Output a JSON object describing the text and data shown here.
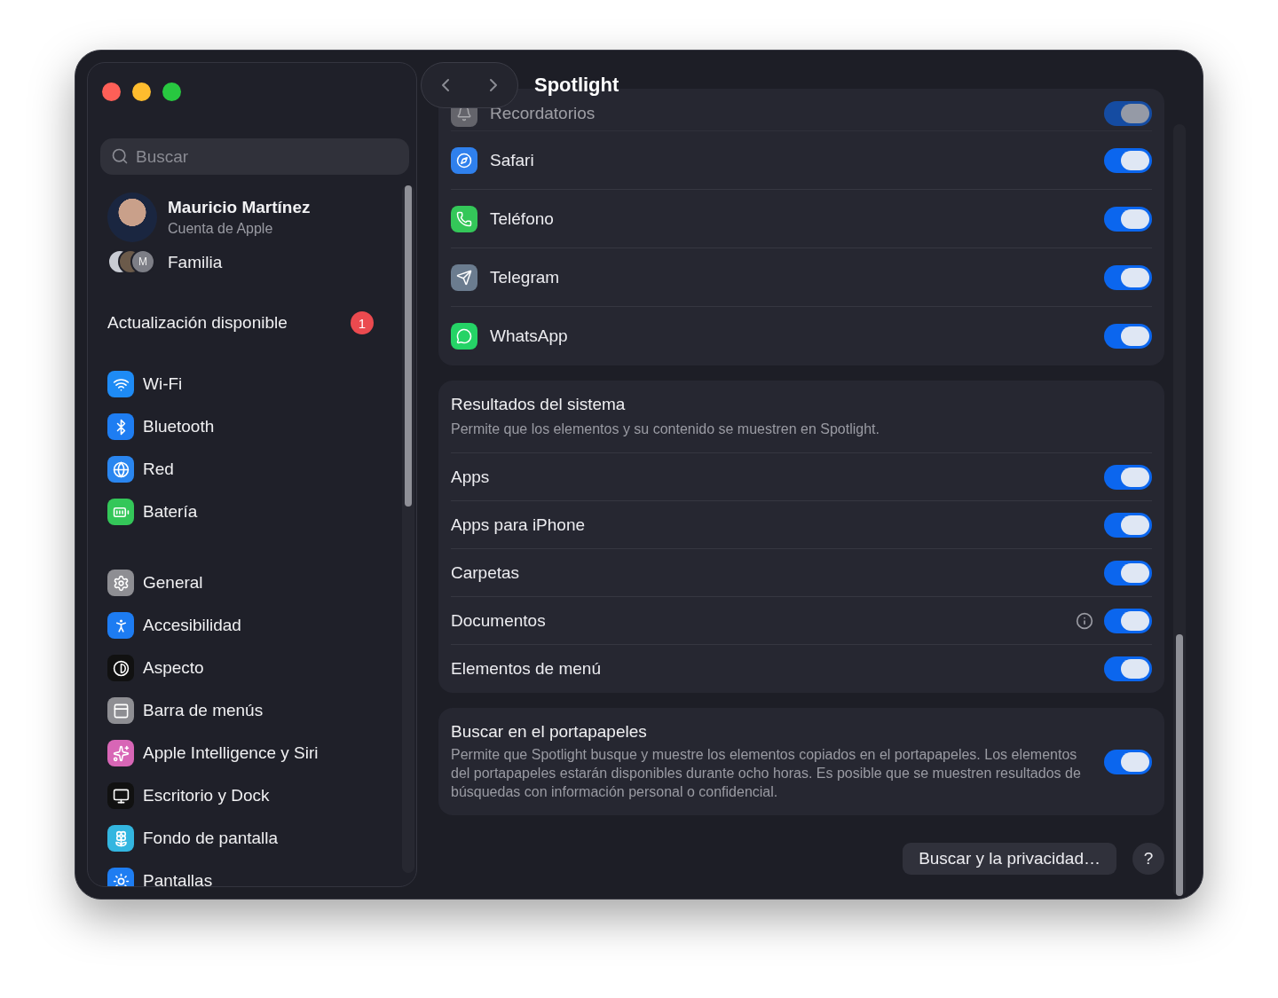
{
  "window": {
    "title": "Spotlight"
  },
  "sidebar": {
    "search": {
      "placeholder": "Buscar"
    },
    "account": {
      "name": "Mauricio Martínez",
      "subtitle": "Cuenta de Apple"
    },
    "family": {
      "label": "Familia",
      "avatar_initial": "M"
    },
    "update": {
      "label": "Actualización disponible",
      "badge": "1"
    },
    "groups": [
      [
        {
          "label": "Wi-Fi"
        },
        {
          "label": "Bluetooth"
        },
        {
          "label": "Red"
        },
        {
          "label": "Batería"
        }
      ],
      [
        {
          "label": "General"
        },
        {
          "label": "Accesibilidad"
        },
        {
          "label": "Aspecto"
        },
        {
          "label": "Barra de menús"
        },
        {
          "label": "Apple Intelligence y Siri"
        },
        {
          "label": "Escritorio y Dock"
        },
        {
          "label": "Fondo de pantalla"
        },
        {
          "label": "Pantallas"
        }
      ]
    ]
  },
  "app_results": [
    {
      "kind": "obscured",
      "label": "Recordatorios",
      "on": true
    },
    {
      "kind": "app",
      "label": "Safari",
      "on": true
    },
    {
      "kind": "app",
      "label": "Teléfono",
      "on": true
    },
    {
      "kind": "app",
      "label": "Telegram",
      "on": true
    },
    {
      "kind": "app",
      "label": "WhatsApp",
      "on": true
    }
  ],
  "system_results": {
    "title": "Resultados del sistema",
    "description": "Permite que los elementos y su contenido se muestren en Spotlight.",
    "rows": [
      {
        "label": "Apps",
        "on": true,
        "info": false
      },
      {
        "label": "Apps para iPhone",
        "on": true,
        "info": false
      },
      {
        "label": "Carpetas",
        "on": true,
        "info": false
      },
      {
        "label": "Documentos",
        "on": true,
        "info": true
      },
      {
        "label": "Elementos de menú",
        "on": true,
        "info": false
      }
    ]
  },
  "clipboard": {
    "title": "Buscar en el portapapeles",
    "description": "Permite que Spotlight busque y muestre los elementos copiados en el portapapeles. Los elementos del portapapeles estarán disponibles durante ocho horas. Es posible que se muestren resultados de búsquedas con información personal o confidencial.",
    "on": true
  },
  "footer": {
    "privacy_button": "Buscar y la privacidad…",
    "help_button": "?"
  }
}
